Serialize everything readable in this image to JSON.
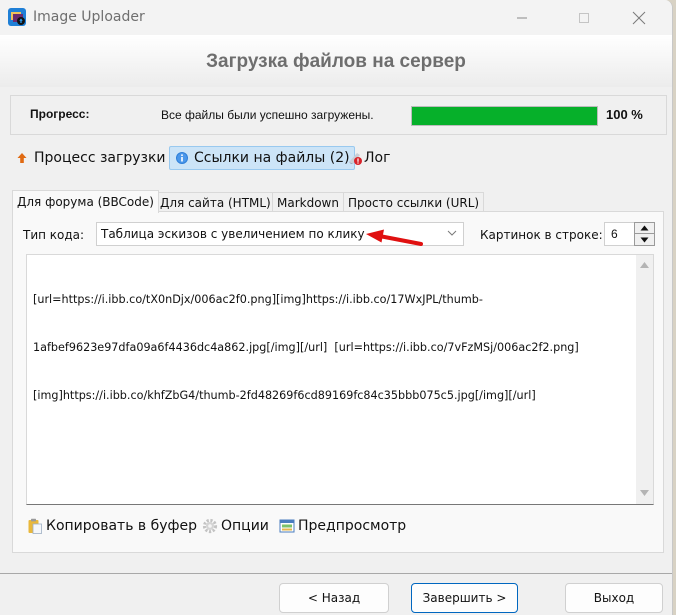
{
  "window": {
    "title": "Image Uploader",
    "controls": {
      "minimize": "—",
      "maximize": "☐",
      "close": "✕"
    }
  },
  "header": {
    "title": "Загрузка файлов на сервер"
  },
  "progress": {
    "label": "Прогресс:",
    "status": "Все файлы были успешно загружены.",
    "percent_value": 100,
    "percent_text": "100 %",
    "bar_color": "#06b02a"
  },
  "mode_tabs": [
    {
      "label": "Процесс загрузки",
      "icon": "upload-arrow-icon",
      "active": false
    },
    {
      "label": "Ссылки на файлы (2)",
      "icon": "info-icon",
      "active": true
    },
    {
      "label": "Лог",
      "icon": "log-error-icon",
      "active": false
    }
  ],
  "format_tabs": [
    {
      "label": "Для форума (BBCode)",
      "active": true
    },
    {
      "label": "Для сайта (HTML)",
      "active": false
    },
    {
      "label": "Markdown",
      "active": false
    },
    {
      "label": "Просто ссылки (URL)",
      "active": false
    }
  ],
  "options": {
    "code_type_label": "Тип кода:",
    "code_type_value": "Таблица эскизов с увеличением по клику",
    "per_row_label": "Картинок в строке:",
    "per_row_value": "6"
  },
  "code_lines": [
    "[url=https://i.ibb.co/tX0nDjx/006ac2f0.png][img]https://i.ibb.co/17WxJPL/thumb-",
    "1afbef9623e97dfa09a6f4436dc4a862.jpg[/img][/url]  [url=https://i.ibb.co/7vFzMSj/006ac2f2.png]",
    "[img]https://i.ibb.co/khfZbG4/thumb-2fd48269f6cd89169fc84c35bbb075c5.jpg[/img][/url]"
  ],
  "actions": [
    {
      "label": "Копировать в буфер",
      "icon": "clipboard-icon"
    },
    {
      "label": "Опции",
      "icon": "gear-icon"
    },
    {
      "label": "Предпросмотр",
      "icon": "preview-icon"
    }
  ],
  "footer": {
    "back": "< Назад",
    "finish": "Завершить >",
    "exit": "Выход"
  },
  "annotation": {
    "type": "arrow",
    "color": "#e01010",
    "points_to": "code-type-select"
  }
}
